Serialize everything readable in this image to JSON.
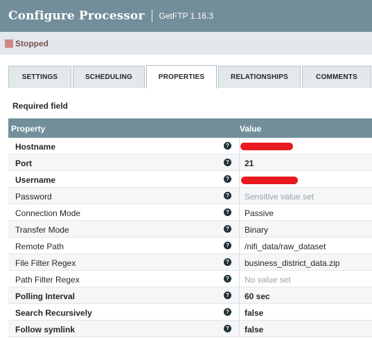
{
  "header": {
    "title": "Configure Processor",
    "subtitle": "GetFTP 1.16.3"
  },
  "status": {
    "label": "Stopped",
    "color": "#d18686"
  },
  "tabs": [
    {
      "label": "SETTINGS",
      "active": false
    },
    {
      "label": "SCHEDULING",
      "active": false
    },
    {
      "label": "PROPERTIES",
      "active": true
    },
    {
      "label": "RELATIONSHIPS",
      "active": false
    },
    {
      "label": "COMMENTS",
      "active": false
    }
  ],
  "required_label": "Required field",
  "table": {
    "columns": {
      "property": "Property",
      "value": "Value"
    },
    "rows": [
      {
        "name": "Hostname",
        "value": "",
        "required": true,
        "redacted": true
      },
      {
        "name": "Port",
        "value": "21",
        "required": true
      },
      {
        "name": "Username",
        "value": "",
        "required": true,
        "redacted": true
      },
      {
        "name": "Password",
        "value": "Sensitive value set",
        "required": false,
        "muted": true
      },
      {
        "name": "Connection Mode",
        "value": "Passive",
        "required": false
      },
      {
        "name": "Transfer Mode",
        "value": "Binary",
        "required": false
      },
      {
        "name": "Remote Path",
        "value": "/nifi_data/raw_dataset",
        "required": false
      },
      {
        "name": "File Filter Regex",
        "value": "business_district_data.zip",
        "required": false
      },
      {
        "name": "Path Filter Regex",
        "value": "No value set",
        "required": false,
        "muted": true
      },
      {
        "name": "Polling Interval",
        "value": "60 sec",
        "required": true
      },
      {
        "name": "Search Recursively",
        "value": "false",
        "required": true
      },
      {
        "name": "Follow symlink",
        "value": "false",
        "required": true
      }
    ]
  },
  "icons": {
    "help": "question-circle-icon",
    "help_glyph": "?"
  },
  "colors": {
    "header_bg": "#728e9b",
    "redaction": "#e8191f"
  }
}
